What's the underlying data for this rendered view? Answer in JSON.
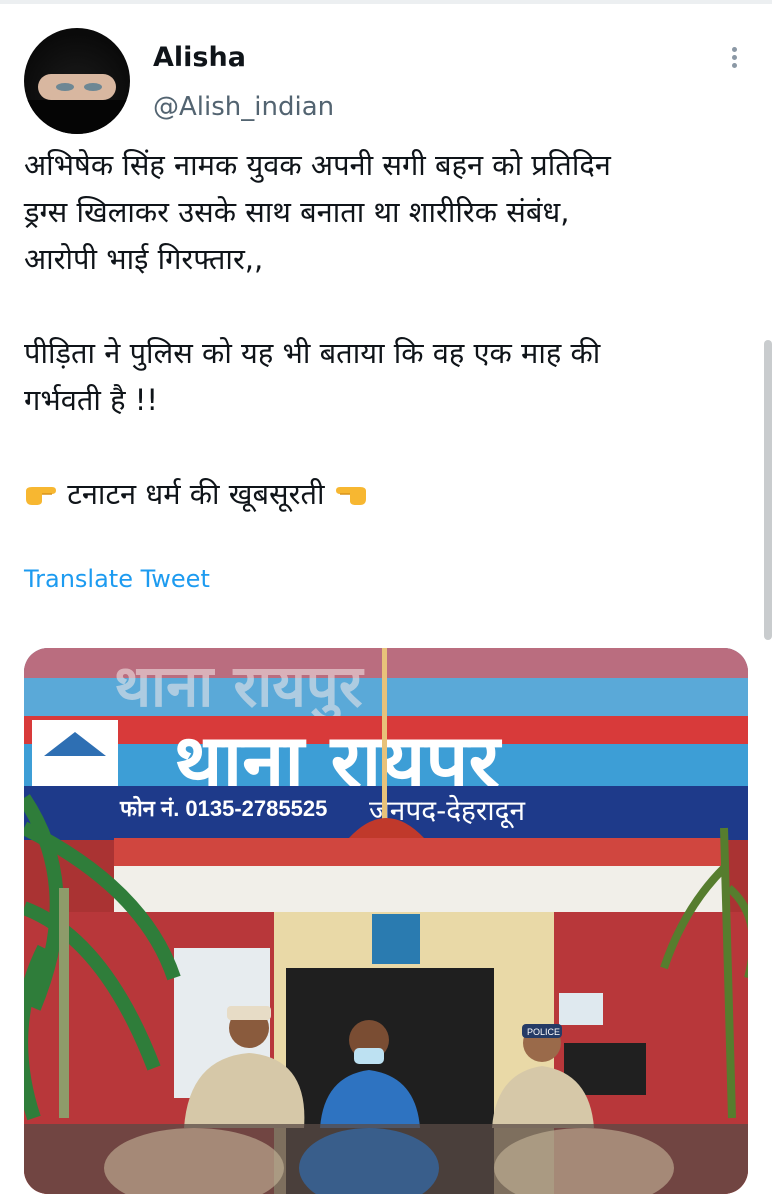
{
  "tweet": {
    "author_name": "Alisha",
    "author_handle": "@Alish_indian",
    "paragraph1_line1": "अभिषेक सिंह नामक युवक अपनी सगी बहन को प्रतिदिन",
    "paragraph1_line2": "ड्रग्स खिलाकर उसके साथ बनाता था शारीरिक संबंध,",
    "paragraph1_line3": "आरोपी भाई गिरफ्तार,,",
    "paragraph2_line1": "पीड़िता ने पुलिस को यह भी बताया कि वह एक माह की",
    "paragraph2_line2": "गर्भवती है !!",
    "paragraph3": "टनाटन धर्म की खूबसूरती",
    "translate_label": "Translate Tweet"
  },
  "icons": {
    "left_emoji": "pointing-right-hand-icon",
    "right_emoji": "pointing-left-hand-icon",
    "more": "more-options-icon"
  },
  "photo": {
    "sign_title": "थाना रायपुर",
    "sign_phone": "फोन नं. 0135-2785525",
    "sign_district": "जनपद-देहरादून",
    "police_badge": "POLICE"
  },
  "colors": {
    "link": "#1d9bf0",
    "handle": "#536471",
    "text": "#0f1419"
  }
}
